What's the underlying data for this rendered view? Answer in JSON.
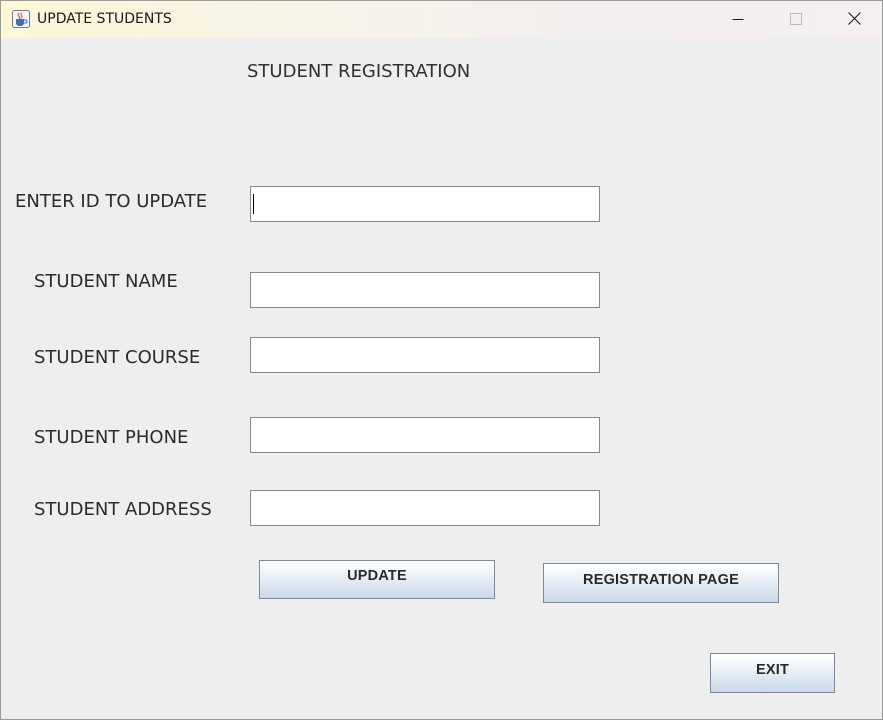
{
  "window": {
    "title": "UPDATE STUDENTS",
    "icon": "java-cup-icon",
    "controls": [
      "minimize-icon",
      "maximize-icon",
      "close-icon"
    ]
  },
  "form": {
    "heading": "STUDENT REGISTRATION",
    "fields": [
      {
        "label": "ENTER ID TO UPDATE",
        "value": "",
        "placeholder": ""
      },
      {
        "label": "STUDENT NAME",
        "value": "",
        "placeholder": ""
      },
      {
        "label": "STUDENT COURSE",
        "value": "",
        "placeholder": ""
      },
      {
        "label": "STUDENT PHONE",
        "value": "",
        "placeholder": ""
      },
      {
        "label": "STUDENT ADDRESS",
        "value": "",
        "placeholder": ""
      }
    ]
  },
  "buttons": {
    "update": "UPDATE",
    "registration_page": "REGISTRATION PAGE",
    "exit": "EXIT"
  },
  "colors": {
    "background": "#eeeeee",
    "button_gradient_top": "#ffffff",
    "button_gradient_bottom": "#c9d8e8",
    "field_border": "#7d8a97"
  }
}
